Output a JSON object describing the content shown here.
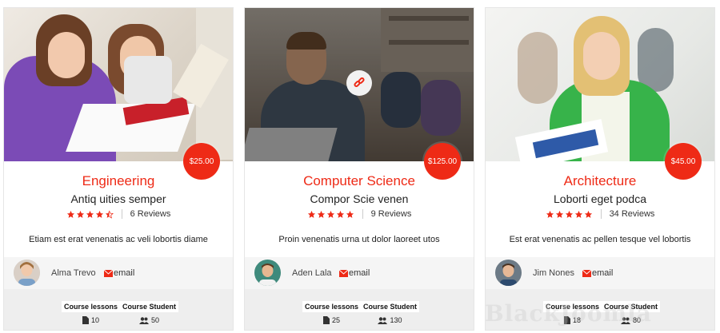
{
  "accent_color": "#ee2a16",
  "courses": [
    {
      "price": "$25.00",
      "title": "Engineering",
      "subtitle": "Antiq uities semper",
      "rating": 4.5,
      "reviews": "6 Reviews",
      "description": "Etiam est erat venenatis ac veli lobortis diame",
      "author": "Alma Trevo",
      "email_label": "email",
      "lessons_label": "Course lessons",
      "lessons": "10",
      "students_label": "Course Student",
      "students": "50",
      "has_link_overlay": false
    },
    {
      "price": "$125.00",
      "title": "Computer Science",
      "subtitle": "Compor Scie venen",
      "rating": 5,
      "reviews": "9 Reviews",
      "description": "Proin venenatis urna ut dolor laoreet utos",
      "author": "Aden Lala",
      "email_label": "email",
      "lessons_label": "Course lessons",
      "lessons": "25",
      "students_label": "Course Student",
      "students": "130",
      "has_link_overlay": true
    },
    {
      "price": "$45.00",
      "title": "Architecture",
      "subtitle": "Loborti eget podca",
      "rating": 5,
      "reviews": "34 Reviews",
      "description": "Est erat venenatis ac pellen tesque vel lobortis",
      "author": "Jim Nones",
      "email_label": "email",
      "lessons_label": "Course lessons",
      "lessons": "18",
      "students_label": "Course Student",
      "students": "80",
      "has_link_overlay": false
    }
  ],
  "icons": {
    "star": "star-icon",
    "half_star": "star-half-icon",
    "email": "envelope-icon",
    "lessons": "file-icon",
    "students": "users-icon",
    "link": "link-icon"
  },
  "watermark": "BlackJoomla"
}
